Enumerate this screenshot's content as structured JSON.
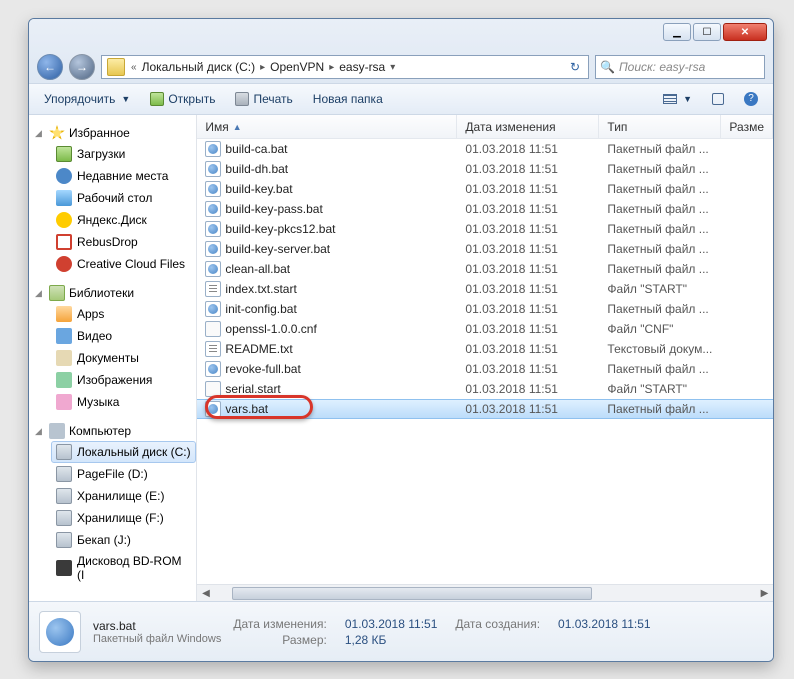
{
  "titlebar": {
    "min": "min",
    "max": "max",
    "close": "close"
  },
  "nav_arrows": {
    "back": "←",
    "fwd": "→"
  },
  "breadcrumb": {
    "sep_first": "«",
    "items": [
      "Локальный диск (C:)",
      "OpenVPN",
      "easy-rsa"
    ],
    "sep": "▸",
    "end_drop": "▾",
    "refresh": "↻"
  },
  "search": {
    "icon": "🔍",
    "placeholder": "Поиск: easy-rsa"
  },
  "toolbar": {
    "organize": "Упорядочить",
    "open": "Открыть",
    "print": "Печать",
    "newfolder": "Новая папка",
    "drop": "▼",
    "help": "?"
  },
  "navpane": {
    "fav_head": "Избранное",
    "fav": [
      "Загрузки",
      "Недавние места",
      "Рабочий стол",
      "Яндекс.Диск",
      "RebusDrop",
      "Creative Cloud Files"
    ],
    "lib_head": "Библиотеки",
    "lib": [
      "Apps",
      "Видео",
      "Документы",
      "Изображения",
      "Музыка"
    ],
    "pc_head": "Компьютер",
    "pc": [
      "Локальный диск (C:)",
      "PageFile (D:)",
      "Хранилище (E:)",
      "Хранилище (F:)",
      "Бекап (J:)",
      "Дисковод BD-ROM (I"
    ]
  },
  "columns": {
    "name": "Имя",
    "date": "Дата изменения",
    "type": "Тип",
    "size": "Разме"
  },
  "files": [
    {
      "n": "build-ca.bat",
      "d": "01.03.2018 11:51",
      "t": "Пакетный файл ...",
      "k": "bat"
    },
    {
      "n": "build-dh.bat",
      "d": "01.03.2018 11:51",
      "t": "Пакетный файл ...",
      "k": "bat"
    },
    {
      "n": "build-key.bat",
      "d": "01.03.2018 11:51",
      "t": "Пакетный файл ...",
      "k": "bat"
    },
    {
      "n": "build-key-pass.bat",
      "d": "01.03.2018 11:51",
      "t": "Пакетный файл ...",
      "k": "bat"
    },
    {
      "n": "build-key-pkcs12.bat",
      "d": "01.03.2018 11:51",
      "t": "Пакетный файл ...",
      "k": "bat"
    },
    {
      "n": "build-key-server.bat",
      "d": "01.03.2018 11:51",
      "t": "Пакетный файл ...",
      "k": "bat"
    },
    {
      "n": "clean-all.bat",
      "d": "01.03.2018 11:51",
      "t": "Пакетный файл ...",
      "k": "bat"
    },
    {
      "n": "index.txt.start",
      "d": "01.03.2018 11:51",
      "t": "Файл \"START\"",
      "k": "txt"
    },
    {
      "n": "init-config.bat",
      "d": "01.03.2018 11:51",
      "t": "Пакетный файл ...",
      "k": "bat"
    },
    {
      "n": "openssl-1.0.0.cnf",
      "d": "01.03.2018 11:51",
      "t": "Файл \"CNF\"",
      "k": "cfg"
    },
    {
      "n": "README.txt",
      "d": "01.03.2018 11:51",
      "t": "Текстовый докум...",
      "k": "txt"
    },
    {
      "n": "revoke-full.bat",
      "d": "01.03.2018 11:51",
      "t": "Пакетный файл ...",
      "k": "bat"
    },
    {
      "n": "serial.start",
      "d": "01.03.2018 11:51",
      "t": "Файл \"START\"",
      "k": "cfg"
    },
    {
      "n": "vars.bat",
      "d": "01.03.2018 11:51",
      "t": "Пакетный файл ...",
      "k": "bat",
      "sel": true
    }
  ],
  "details": {
    "name": "vars.bat",
    "type": "Пакетный файл Windows",
    "mod_label": "Дата изменения:",
    "mod_value": "01.03.2018 11:51",
    "size_label": "Размер:",
    "size_value": "1,28 КБ",
    "create_label": "Дата создания:",
    "create_value": "01.03.2018 11:51"
  }
}
